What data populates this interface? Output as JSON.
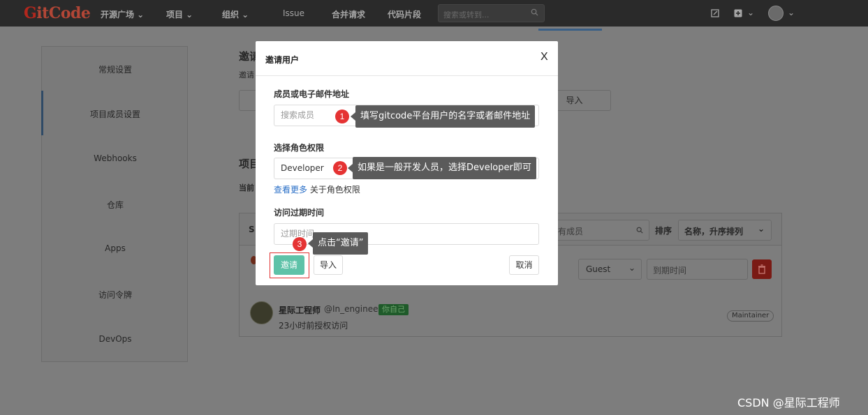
{
  "navbar": {
    "logo_g": "G",
    "logo_rest": "itCode",
    "items": [
      "开源广场 ⌄",
      "项目 ⌄",
      "组织 ⌄",
      "Issue",
      "合并请求",
      "代码片段"
    ],
    "search_placeholder": "搜索或转到...",
    "right_icons": [
      "edit-icon",
      "plus-icon",
      "avatar"
    ]
  },
  "sidebar": {
    "items": [
      "常规设置",
      "项目成员设置",
      "Webhooks",
      "仓库",
      "Apps",
      "访问令牌",
      "DevOps"
    ],
    "active_index": 1
  },
  "background": {
    "invite_heading_fragment": "邀请",
    "invite_sub_fragment": "邀请",
    "import_button": "导入",
    "project_heading_fragment": "项目",
    "current_fragment": "当前",
    "panel_s": "S",
    "search_members_placeholder": "有成员",
    "sort_label": "排序",
    "sort_value": "名称，升序排列",
    "guest_role": "Guest",
    "expire_placeholder": "到期时间",
    "member_name": "星际工程师",
    "member_handle": "@In_engineer",
    "self_badge": "你自己",
    "member_time": "23小时前授权访问",
    "role_badge": "Maintainer"
  },
  "modal": {
    "title": "邀请用户",
    "close": "X",
    "member_label": "成员或电子邮件地址",
    "member_placeholder": "搜索成员",
    "role_label": "选择角色权限",
    "role_value": "Developer",
    "more_link": "查看更多",
    "more_rest": "关于角色权限",
    "expire_label": "访问过期时间",
    "expire_placeholder": "过期时间",
    "invite_button": "邀请",
    "import_button": "导入",
    "cancel_button": "取消"
  },
  "callouts": [
    {
      "step": "1",
      "text": "填写gitcode平台用户的名字或者邮件地址"
    },
    {
      "step": "2",
      "text": "如果是一般开发人员，选择Developer即可"
    },
    {
      "step": "3",
      "text": "点击“邀请”"
    }
  ],
  "watermark": "CSDN @星际工程师",
  "colors": {
    "accent": "#5ec2a8",
    "step_dot": "#e53333",
    "link": "#2a6fc7",
    "highlight_frame": "#e03030"
  }
}
